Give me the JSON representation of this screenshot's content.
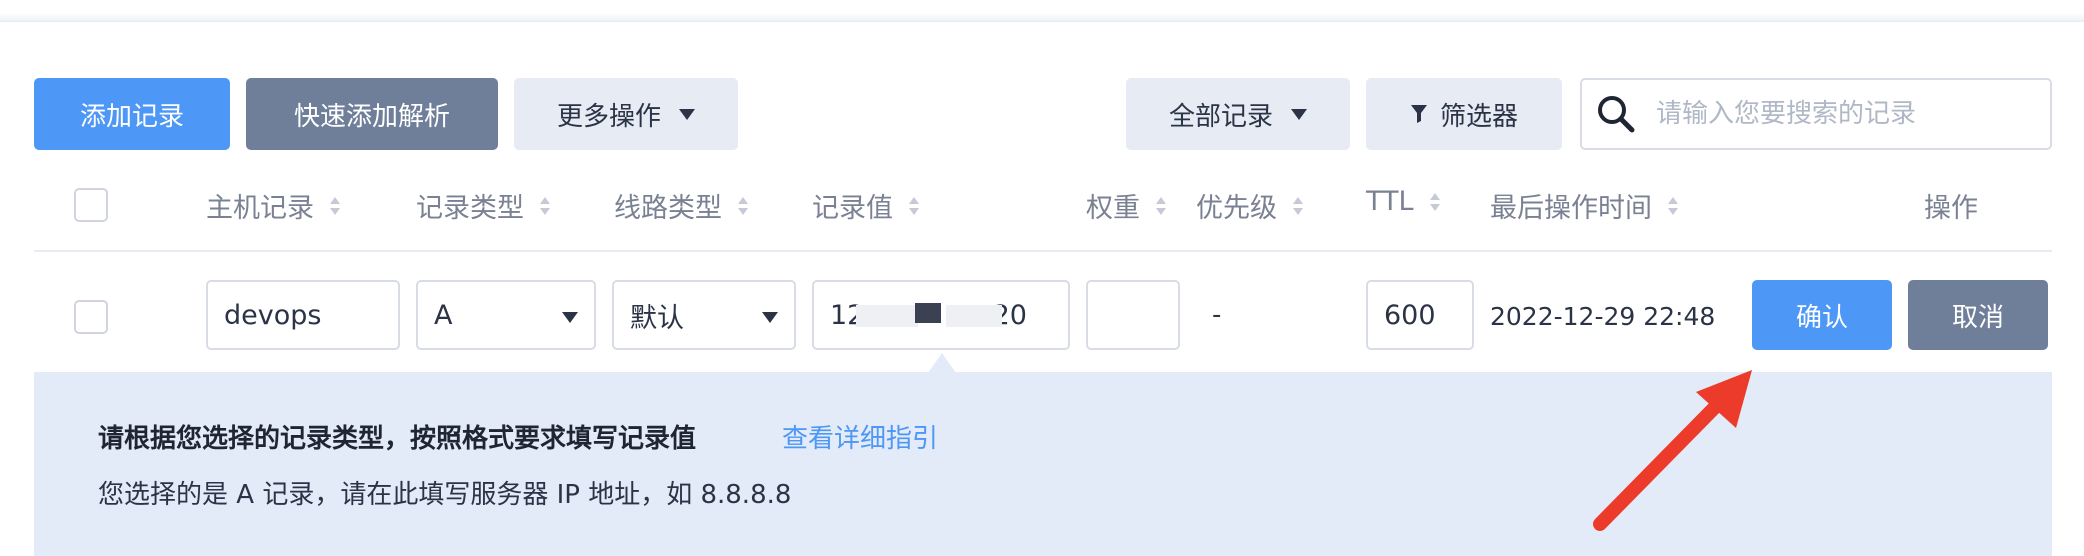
{
  "toolbar": {
    "add_record": "添加记录",
    "quick_add": "快速添加解析",
    "more_actions": "更多操作",
    "all_records": "全部记录",
    "filter": "筛选器",
    "search_placeholder": "请输入您要搜索的记录"
  },
  "table": {
    "columns": [
      "主机记录",
      "记录类型",
      "线路类型",
      "记录值",
      "权重",
      "优先级",
      "TTL",
      "最后操作时间",
      "操作"
    ]
  },
  "edit_row": {
    "host": "devops",
    "type": "A",
    "line": "默认",
    "value": "12",
    "value_tail": ".20",
    "weight": "",
    "priority": "-",
    "ttl": "600",
    "last_modified": "2022-12-29 22:48",
    "confirm": "确认",
    "cancel": "取消"
  },
  "hint": {
    "title": "请根据您选择的记录类型，按照格式要求填写记录值",
    "guide_link": "查看详细指引",
    "detail": "您选择的是 A 记录，请在此填写服务器 IP 地址，如 8.8.8.8"
  },
  "colors": {
    "primary": "#4d97f6",
    "secondary": "#6f7f9a",
    "annotation_arrow": "#ec3b2b",
    "hint_bg": "#e3ebf8"
  }
}
